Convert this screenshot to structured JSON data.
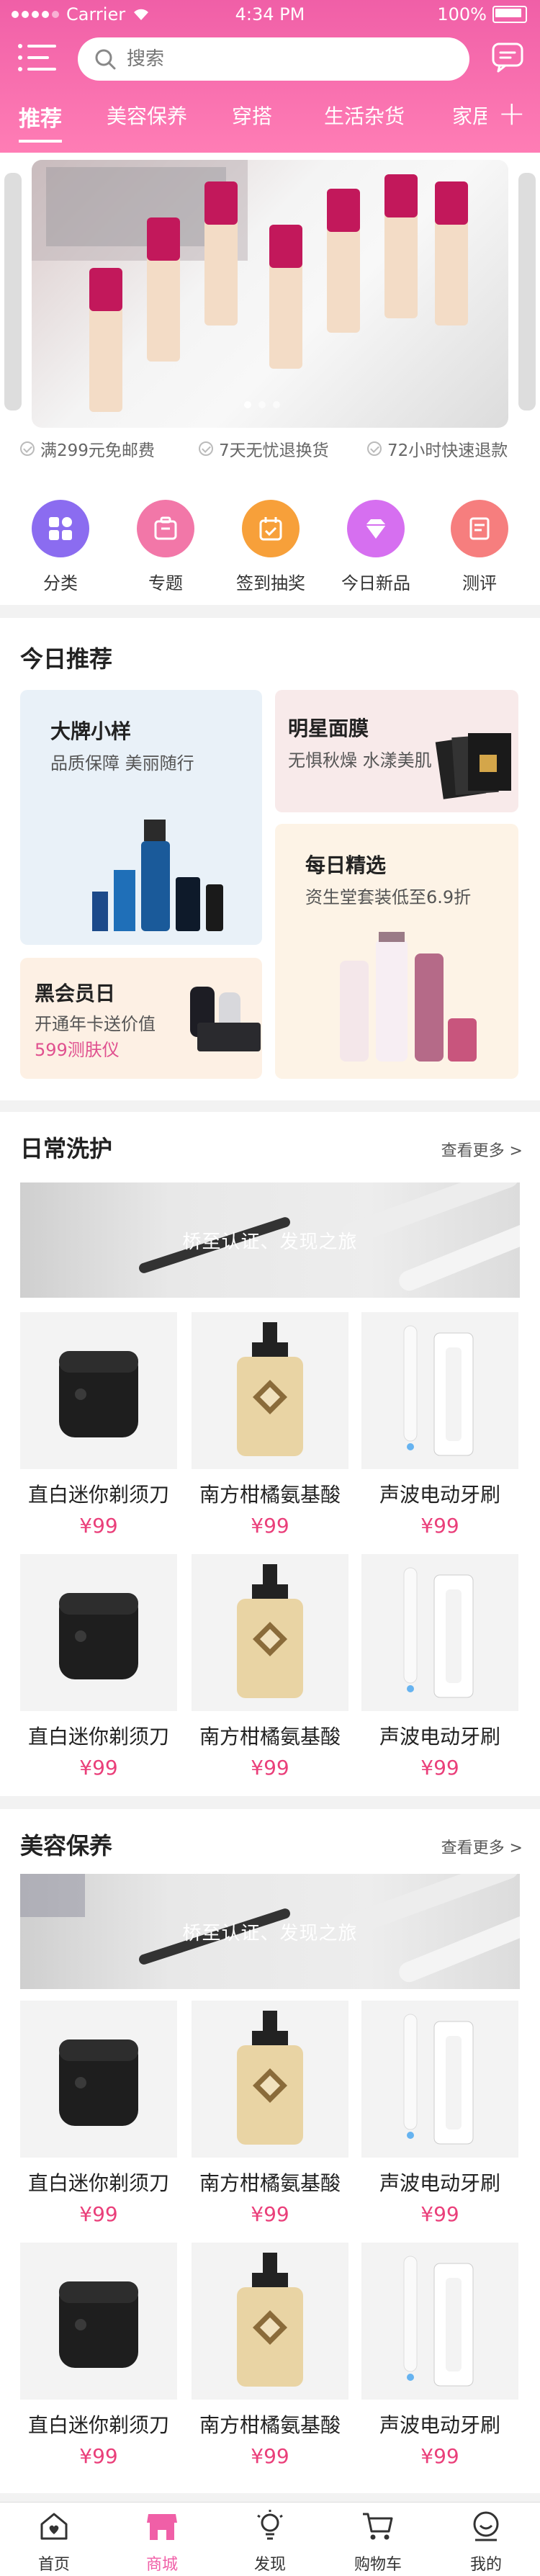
{
  "status_bar": {
    "carrier": "Carrier",
    "time": "4:34 PM",
    "battery": "100%"
  },
  "header": {
    "search_placeholder": "搜索",
    "tabs": [
      {
        "label": "推荐",
        "active": true
      },
      {
        "label": "美容保养"
      },
      {
        "label": "穿搭"
      },
      {
        "label": "生活杂货"
      },
      {
        "label": "家居"
      }
    ],
    "plus": "+",
    "accent": "#f05fa7"
  },
  "guarantees": [
    "满299元免邮费",
    "7天无忧退换货",
    "72小时快速退款"
  ],
  "quick_icons": [
    {
      "label": "分类",
      "icon": "grid-icon",
      "color": "#8b6cf0"
    },
    {
      "label": "专题",
      "icon": "briefcase-icon",
      "color": "#f277a8"
    },
    {
      "label": "签到抽奖",
      "icon": "calendar-icon",
      "color": "#f7a03a"
    },
    {
      "label": "今日新品",
      "icon": "diamond-icon",
      "color": "#d66ff0"
    },
    {
      "label": "测评",
      "icon": "note-icon",
      "color": "#f67e7e"
    }
  ],
  "today": {
    "title": "今日推荐",
    "cards": [
      {
        "title": "大牌小样",
        "subtitle": "品质保障 美丽随行",
        "bg": "#e9f1f8"
      },
      {
        "title": "明星面膜",
        "subtitle": "无惧秋燥 水漾美肌",
        "bg": "#f8eaea"
      },
      {
        "title": "每日精选",
        "subtitle": "资生堂套装低至6.9折",
        "bg": "#fdf3e6"
      },
      {
        "title": "黑会员日",
        "subtitle": "开通年卡送价值",
        "subtitle2": "599测肤仪",
        "bg": "#fdf0e4"
      }
    ]
  },
  "daily": {
    "title": "日常洗护",
    "more": "查看更多 >",
    "banner_caption": "桥至认证、发现之旅",
    "products": [
      {
        "name": "直白迷你剃须刀",
        "price": "¥99",
        "kind": "shaver"
      },
      {
        "name": "南方柑橘氨基酸",
        "price": "¥99",
        "kind": "bottle"
      },
      {
        "name": "声波电动牙刷",
        "price": "¥99",
        "kind": "toothbrush"
      },
      {
        "name": "直白迷你剃须刀",
        "price": "¥99",
        "kind": "shaver"
      },
      {
        "name": "南方柑橘氨基酸",
        "price": "¥99",
        "kind": "bottle"
      },
      {
        "name": "声波电动牙刷",
        "price": "¥99",
        "kind": "toothbrush"
      }
    ]
  },
  "beauty": {
    "title": "美容保养",
    "more": "查看更多 >",
    "banner_caption": "桥至认证、发现之旅",
    "products": [
      {
        "name": "直白迷你剃须刀",
        "price": "¥99",
        "kind": "shaver"
      },
      {
        "name": "南方柑橘氨基酸",
        "price": "¥99",
        "kind": "bottle"
      },
      {
        "name": "声波电动牙刷",
        "price": "¥99",
        "kind": "toothbrush"
      },
      {
        "name": "直白迷你剃须刀",
        "price": "¥99",
        "kind": "shaver"
      },
      {
        "name": "南方柑橘氨基酸",
        "price": "¥99",
        "kind": "bottle"
      },
      {
        "name": "声波电动牙刷",
        "price": "¥99",
        "kind": "toothbrush"
      }
    ]
  },
  "bottom_nav": [
    {
      "label": "首页",
      "icon": "home-icon"
    },
    {
      "label": "商城",
      "icon": "shop-icon",
      "active": true
    },
    {
      "label": "发现",
      "icon": "bulb-icon"
    },
    {
      "label": "购物车",
      "icon": "cart-icon"
    },
    {
      "label": "我的",
      "icon": "user-icon"
    }
  ]
}
